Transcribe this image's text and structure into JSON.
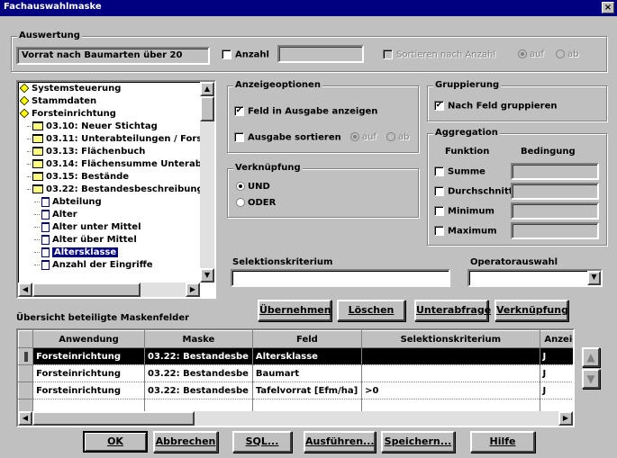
{
  "window": {
    "title": "Fachauswahlmaske",
    "close": "×"
  },
  "auswertung": {
    "label": "Auswertung",
    "value": "Vorrat nach Baumarten über 20",
    "anzahl_label": "Anzahl",
    "anzahl_value": "",
    "sort_label": "Sortieren nach Anzahl",
    "auf": "auf",
    "ab": "ab"
  },
  "tree": {
    "items": [
      {
        "label": "Systemsteuerung",
        "icon": "diamond",
        "level": 0
      },
      {
        "label": "Stammdaten",
        "icon": "diamond",
        "level": 0
      },
      {
        "label": "Forsteinrichtung",
        "icon": "diamond",
        "level": 0
      },
      {
        "label": "03.10: Neuer Stichtag",
        "icon": "folder",
        "level": 1
      },
      {
        "label": "03.11: Unterabteilungen / Forstc",
        "icon": "folder",
        "level": 1
      },
      {
        "label": "03.13: Flächenbuch",
        "icon": "folder",
        "level": 1
      },
      {
        "label": "03.14: Flächensumme Unterabt",
        "icon": "folder",
        "level": 1
      },
      {
        "label": "03.15: Bestände",
        "icon": "folder",
        "level": 1
      },
      {
        "label": "03.22: Bestandesbeschreibung",
        "icon": "folder",
        "level": 1
      },
      {
        "label": "Abteilung",
        "icon": "doc",
        "level": 2
      },
      {
        "label": "Alter",
        "icon": "doc",
        "level": 2
      },
      {
        "label": "Alter unter Mittel",
        "icon": "doc",
        "level": 2
      },
      {
        "label": "Alter über Mittel",
        "icon": "doc",
        "level": 2
      },
      {
        "label": "Altersklasse",
        "icon": "doc",
        "level": 2,
        "selected": true
      },
      {
        "label": "Anzahl der Eingriffe",
        "icon": "doc",
        "level": 2
      }
    ]
  },
  "anzeige": {
    "label": "Anzeigeoptionen",
    "feld_label": "Feld in Ausgabe anzeigen",
    "feld_checked": "✔",
    "sort_label": "Ausgabe sortieren",
    "sort_checked": "",
    "auf": "auf",
    "ab": "ab"
  },
  "verknuepfung": {
    "label": "Verknüpfung",
    "und": "UND",
    "oder": "ODER"
  },
  "gruppierung": {
    "label": "Gruppierung",
    "nach_feld": "Nach Feld gruppieren",
    "checked": "✔"
  },
  "aggregation": {
    "label": "Aggregation",
    "funktion": "Funktion",
    "bedingung": "Bedingung",
    "items": [
      "Summe",
      "Durchschnitt",
      "Minimum",
      "Maximum"
    ]
  },
  "selektion": {
    "label": "Selektionskriterium",
    "value": ""
  },
  "operator": {
    "label": "Operatorauswahl",
    "value": ""
  },
  "actions": {
    "uebernehmen": "Übernehmen",
    "loeschen": "Löschen",
    "unterabfrage": "Unterabfrage",
    "verknuepfung": "Verknüpfung"
  },
  "uebersicht": {
    "label": "Übersicht beteiligte Maskenfelder",
    "columns": [
      "Anwendung",
      "Maske",
      "Feld",
      "Selektionskriterium",
      "Anzeiger"
    ],
    "rows": [
      [
        "Forsteinrichtung",
        "03.22: Bestandesbe",
        "Altersklasse",
        "",
        "J"
      ],
      [
        "Forsteinrichtung",
        "03.22: Bestandesbe",
        "Baumart",
        "",
        "J"
      ],
      [
        "Forsteinrichtung",
        "03.22: Bestandesbe",
        "Tafelvorrat [Efm/ha]",
        ">0",
        "J"
      ]
    ]
  },
  "footer": {
    "ok": "OK",
    "abbrechen": "Abbrechen",
    "sql": "SQL...",
    "ausfuehren": "Ausführen...",
    "speichern": "Speichern...",
    "hilfe": "Hilfe"
  }
}
